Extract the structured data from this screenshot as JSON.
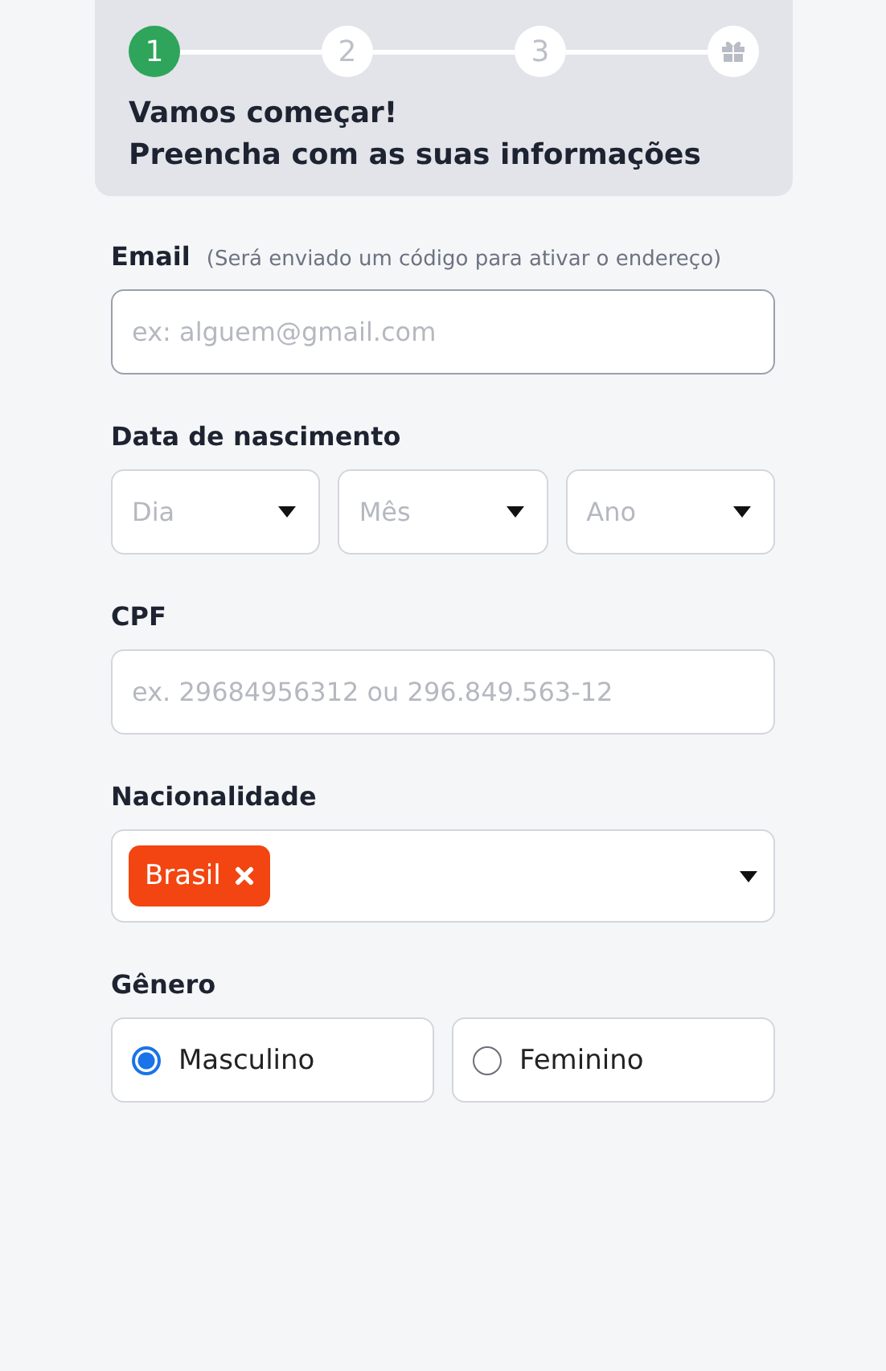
{
  "steps": [
    {
      "kind": "number",
      "label": "1",
      "selected": true
    },
    {
      "kind": "number",
      "label": "2",
      "selected": false
    },
    {
      "kind": "number",
      "label": "3",
      "selected": false
    },
    {
      "kind": "gift",
      "selected": false
    }
  ],
  "heading": [
    "Vamos começar!",
    "Preencha com as suas informações"
  ],
  "email": {
    "label": "Email",
    "hint": "(Será enviado um código para ativar o endereço)",
    "placeholder": "ex: alguem@gmail.com"
  },
  "birth": {
    "label": "Data de nascimento",
    "selects": [
      {
        "placeholder": "Dia"
      },
      {
        "placeholder": "Mês"
      },
      {
        "placeholder": "Ano"
      }
    ]
  },
  "cpf": {
    "label": "CPF",
    "placeholder": "ex. 29684956312 ou 296.849.563-12"
  },
  "nationality": {
    "label": "Nacionalidade",
    "tags": [
      {
        "label": "Brasil",
        "color": "#f24511"
      }
    ]
  },
  "gender": {
    "label": "Gênero",
    "options": [
      {
        "label": "Masculino",
        "selected": true
      },
      {
        "label": "Feminino",
        "selected": false
      }
    ]
  }
}
